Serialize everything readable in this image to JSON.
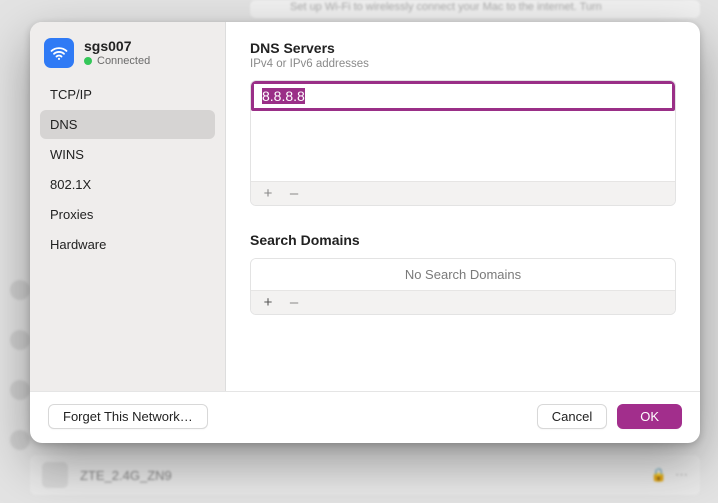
{
  "background": {
    "banner_text": "Set up Wi-Fi to wirelessly connect your Mac to the internet. Turn",
    "network_row": "ZTE_2.4G_ZN9"
  },
  "network": {
    "name": "sgs007",
    "status": "Connected"
  },
  "sidebar": {
    "items": [
      {
        "label": "TCP/IP"
      },
      {
        "label": "DNS"
      },
      {
        "label": "WINS"
      },
      {
        "label": "802.1X"
      },
      {
        "label": "Proxies"
      },
      {
        "label": "Hardware"
      }
    ],
    "selected_index": 1
  },
  "dns": {
    "title": "DNS Servers",
    "subtitle": "IPv4 or IPv6 addresses",
    "entries": [
      "8.8.8.8"
    ],
    "add": "+",
    "remove": "–"
  },
  "search_domains": {
    "title": "Search Domains",
    "empty_text": "No Search Domains",
    "add": "+",
    "remove": "–"
  },
  "footer": {
    "forget": "Forget This Network…",
    "cancel": "Cancel",
    "ok": "OK"
  }
}
